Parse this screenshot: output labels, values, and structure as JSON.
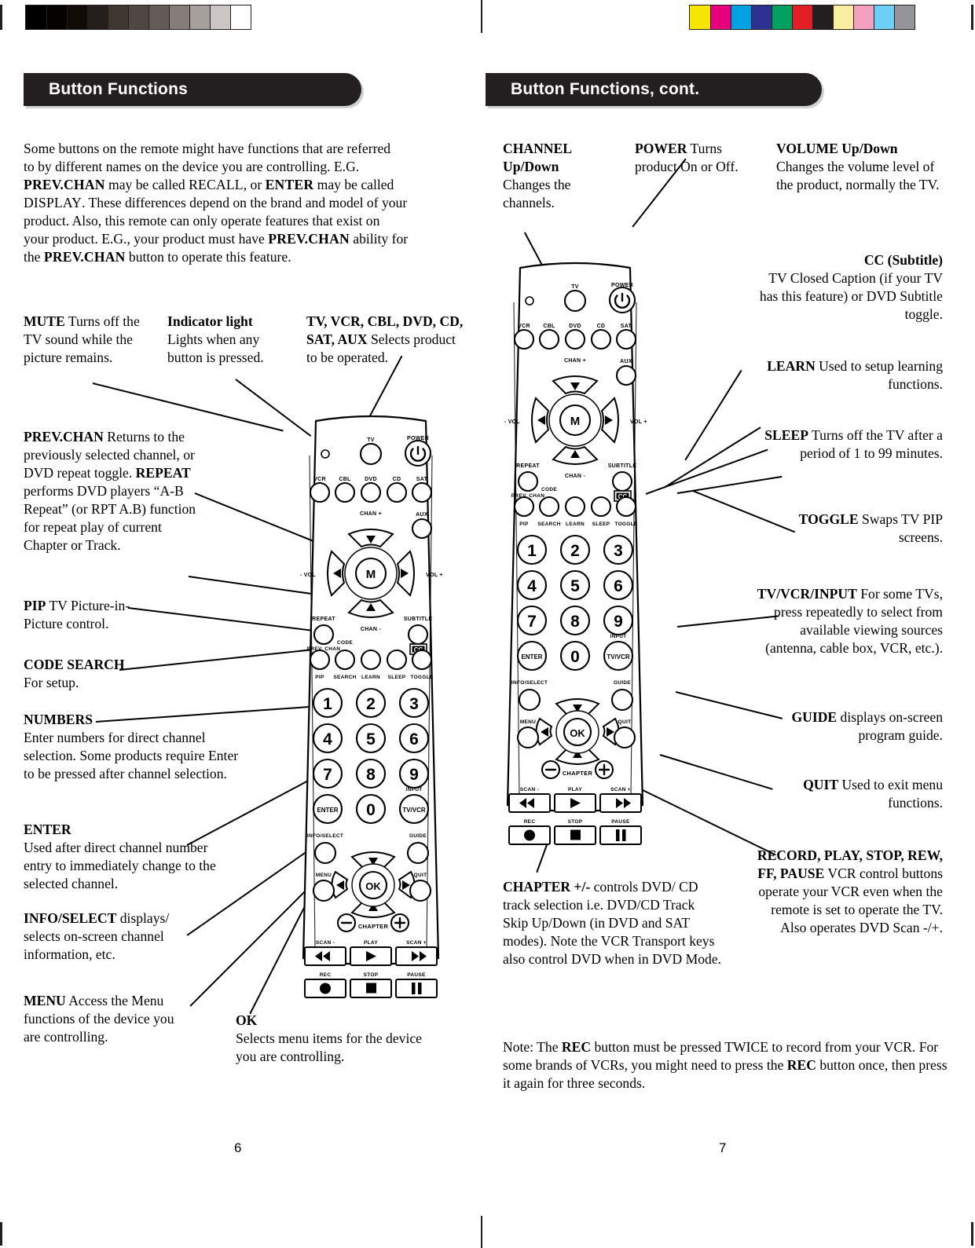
{
  "document": {
    "type": "remote-control-manual-spread",
    "left_page_number": "6",
    "right_page_number": "7"
  },
  "calibration": {
    "grayscale_label": "grayscale-step-wedge",
    "grayscale_swatches": [
      "#000000",
      "#050302",
      "#110b07",
      "#241f1c",
      "#3e3631",
      "#504742",
      "#645b57",
      "#857d79",
      "#a5a09c",
      "#cac6c3",
      "#ffffff"
    ],
    "color_label": "color-control-patches",
    "color_swatches": [
      "#f6e500",
      "#e5007d",
      "#00a0e4",
      "#2e3192",
      "#00a160",
      "#e31f26",
      "#231f20",
      "#faeea0",
      "#f4a0c0",
      "#6dcff6",
      "#939598"
    ]
  },
  "left_page": {
    "banner_title": "Button Functions",
    "intro": {
      "line1": "Some buttons on the remote might have functions that are referred",
      "line2": "to by different names on the device you are controlling. E.G.",
      "line3_a": "PREV.CHAN",
      "line3_b": " may be called ",
      "line3_c": "RECALL",
      "line3_d": ", or ",
      "line3_e": "ENTER",
      "line3_f": " may be called",
      "line4_a": "DISPLAY",
      "line4_b": ". These differences depend on the brand and model of your",
      "line5": "product. Also, this remote can only operate features that exist on",
      "line6_a": "your product. E.G., your product must have ",
      "line6_b": "PREV.CHAN",
      "line6_c": " ability for",
      "line7_a": "the ",
      "line7_b": "PREV.CHAN",
      "line7_c": " button to operate this feature."
    },
    "top_callouts": [
      {
        "term": "MUTE",
        "text": " Turns off the TV sound while the picture remains."
      },
      {
        "term": "Indicator light",
        "text": " Lights when any button is pressed."
      },
      {
        "term": "TV, VCR, CBL, DVD, CD, SAT, AUX",
        "text": " Selects product to be operated."
      }
    ],
    "callouts": [
      {
        "term": "PREV.CHAN",
        "text": " Returns to the previously selected channel, or DVD repeat toggle. ",
        "term2": "REPEAT",
        "text2": " performs DVD players “A-B Repeat” (or RPT A.B) function for repeat play of current Chapter or Track."
      },
      {
        "term": "PIP",
        "text": " TV Picture-in-Picture control."
      },
      {
        "term": "CODE SEARCH",
        "text": "For setup."
      },
      {
        "term": "NUMBERS",
        "text": "Enter numbers for direct channel selection. Some products require Enter to be pressed after channel selection."
      },
      {
        "term": "ENTER",
        "text": "Used after direct channel number entry to immediately change to the selected channel."
      },
      {
        "term": "INFO/SELECT",
        "text": " displays/ selects on-screen channel information, etc."
      },
      {
        "term": "MENU",
        "text": " Access the Menu functions of the device you are controlling."
      },
      {
        "term": "OK",
        "text": "Selects menu items for the device you are controlling."
      }
    ]
  },
  "right_page": {
    "banner_title": "Button Functions, cont.",
    "top_callouts": [
      {
        "term": "CHANNEL Up/Down",
        "text": " Changes the  channels."
      },
      {
        "term": "POWER",
        "text": " Turns product On or Off."
      },
      {
        "term": "VOLUME Up/Down",
        "text": " Changes the volume level of the product, normally the TV."
      }
    ],
    "callouts": [
      {
        "term": "CC (Subtitle)",
        "text": "TV Closed Caption (if your TV has this feature) or DVD Subtitle toggle."
      },
      {
        "term": "LEARN",
        "text": " Used to setup learning functions."
      },
      {
        "term": "SLEEP",
        "text": " Turns off the TV after a period of 1 to 99 minutes."
      },
      {
        "term": "TOGGLE",
        "text": " Swaps TV PIP screens."
      },
      {
        "term": "TV/VCR/INPUT",
        "text": " For some TVs, press repeatedly to select from available viewing sources (antenna, cable box, VCR, etc.)."
      },
      {
        "term": "GUIDE",
        "text": " displays on-screen program guide."
      },
      {
        "term": "QUIT",
        "text": " Used to exit menu functions."
      },
      {
        "term": "RECORD, PLAY, STOP, REW, FF, PAUSE",
        "text": " VCR control buttons operate your VCR even when the remote is set to operate the TV. Also operates DVD Scan -/+."
      }
    ],
    "chapter_callout": {
      "term": "CHAPTER +/-",
      "text": " controls DVD/ CD track selection i.e. DVD/CD Track Skip Up/Down (in DVD and SAT modes). Note the VCR Transport keys also control DVD when in DVD Mode."
    },
    "note": {
      "prefix": "Note: The ",
      "bold1": "REC",
      "mid": " button must be pressed TWICE to record from your VCR. For some brands of VCRs, you might need to press the ",
      "bold2": "REC",
      "suffix": " button once, then press it again for three seconds."
    }
  },
  "remote": {
    "label": "universal-remote-control",
    "indicator_light": "indicator-led",
    "device_keys": [
      "TV",
      "POWER",
      "VCR",
      "CBL",
      "DVD",
      "CD",
      "SAT",
      "AUX"
    ],
    "nav_labels": {
      "up": "CHAN +",
      "down": "CHAN -",
      "left": "- VOL",
      "right": "VOL +",
      "center": "M"
    },
    "row_repeat": [
      "REPEAT",
      "SUBTITLE"
    ],
    "row_repeat_sub": [
      "PREV. CHAN",
      "CC"
    ],
    "function_row_top": [
      "",
      "CODE",
      "",
      "",
      ""
    ],
    "function_row": [
      "PIP",
      "SEARCH",
      "LEARN",
      "SLEEP",
      "TOGGLE"
    ],
    "numpad": [
      "1",
      "2",
      "3",
      "4",
      "5",
      "6",
      "7",
      "8",
      "9",
      "ENTER",
      "0",
      "TV/VCR"
    ],
    "numpad_input_label": "INPUT",
    "lower_labels": [
      "INFO/SELECT",
      "GUIDE",
      "MENU",
      "QUIT",
      "OK"
    ],
    "chapter_label": "CHAPTER",
    "chapter_minus": "−",
    "chapter_plus": "+",
    "transport_top": [
      "SCAN -",
      "PLAY",
      "SCAN +"
    ],
    "transport_bottom": [
      "REC",
      "STOP",
      "PAUSE"
    ]
  }
}
